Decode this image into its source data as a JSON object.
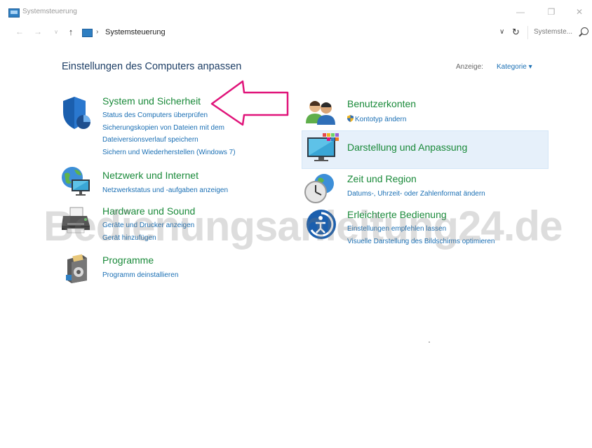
{
  "window": {
    "title": "Systemsteuerung",
    "minimize": "—",
    "maximize": "❐",
    "close": "✕"
  },
  "addressbar": {
    "back": "←",
    "forward": "→",
    "recent": "∨",
    "up": "↑",
    "separator": "›",
    "path": "Systemsteuerung",
    "dropdown": "∨",
    "refresh": "↻",
    "search_placeholder": "Systemste..."
  },
  "main": {
    "title": "Einstellungen des Computers anpassen",
    "view_label": "Anzeige:",
    "view_value": "Kategorie ▾"
  },
  "categories": [
    {
      "title": "System und Sicherheit",
      "links": [
        "Status des Computers überprüfen",
        "Sicherungskopien von Dateien mit dem",
        "Dateiversionsverlauf speichern",
        "Sichern und Wiederherstellen (Windows 7)"
      ]
    },
    {
      "title": "Netzwerk und Internet",
      "links": [
        "Netzwerkstatus und -aufgaben anzeigen"
      ]
    },
    {
      "title": "Hardware und Sound",
      "links": [
        "Geräte und Drucker anzeigen",
        "Gerät hinzufügen"
      ]
    },
    {
      "title": "Programme",
      "links": [
        "Programm deinstallieren"
      ]
    },
    {
      "title": "Benutzerkonten",
      "links": [
        "Kontotyp ändern"
      ]
    },
    {
      "title": "Darstellung und Anpassung",
      "links": []
    },
    {
      "title": "Zeit und Region",
      "links": [
        "Datums-, Uhrzeit- oder Zahlenformat ändern"
      ]
    },
    {
      "title": "Erleichterte Bedienung",
      "links": [
        "Einstellungen empfehlen lassen",
        "Visuelle Darstellung des Bildschirms optimieren"
      ]
    }
  ],
  "watermark": "Bedienungsanleitung24.de",
  "colors": {
    "category_title": "#1a8a3a",
    "link": "#1a6fb4",
    "heading": "#1e3f66",
    "highlight": "#e6f0fa",
    "arrow": "#e0147a"
  }
}
